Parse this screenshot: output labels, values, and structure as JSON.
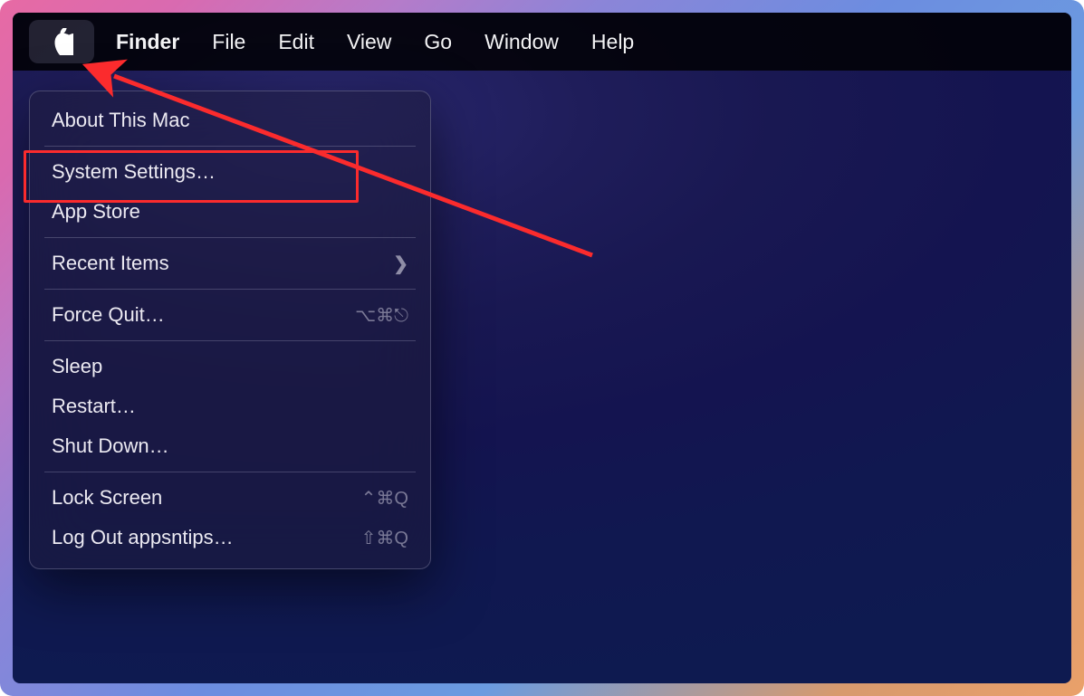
{
  "menubar": {
    "active_app": "Finder",
    "items": [
      "File",
      "Edit",
      "View",
      "Go",
      "Window",
      "Help"
    ]
  },
  "apple_menu": {
    "sections": [
      {
        "items": [
          {
            "label": "About This Mac"
          }
        ]
      },
      {
        "items": [
          {
            "label": "System Settings…"
          },
          {
            "label": "App Store"
          }
        ]
      },
      {
        "items": [
          {
            "label": "Recent Items",
            "submenu": true
          }
        ]
      },
      {
        "items": [
          {
            "label": "Force Quit…",
            "shortcut": "⌥⌘⎋"
          }
        ]
      },
      {
        "items": [
          {
            "label": "Sleep"
          },
          {
            "label": "Restart…"
          },
          {
            "label": "Shut Down…"
          }
        ]
      },
      {
        "items": [
          {
            "label": "Lock Screen",
            "shortcut": "⌃⌘Q"
          },
          {
            "label": "Log Out appsntips…",
            "shortcut": "⇧⌘Q"
          }
        ]
      }
    ]
  },
  "annotation": {
    "highlight_target": "System Settings…",
    "arrow_color": "#fb2b2d"
  }
}
